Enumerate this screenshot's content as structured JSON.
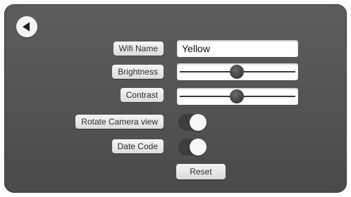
{
  "settings": {
    "back_icon": "back-arrow-icon",
    "wifi_name": {
      "label": "Wifi Name",
      "value": "Yellow"
    },
    "brightness": {
      "label": "Brightness",
      "level_percent": 49
    },
    "contrast": {
      "label": "Contrast",
      "level_percent": 49
    },
    "rotate_camera_view": {
      "label": "Rotate Camera view",
      "enabled": false
    },
    "date_code": {
      "label": "Date Code",
      "enabled": false
    },
    "reset_label": "Reset"
  },
  "colors": {
    "screen_background": "#555555",
    "control_background": "#f2f2f2",
    "toggle_off_track": "#3d3d3d",
    "slider_thumb": "#3f3f3f"
  }
}
